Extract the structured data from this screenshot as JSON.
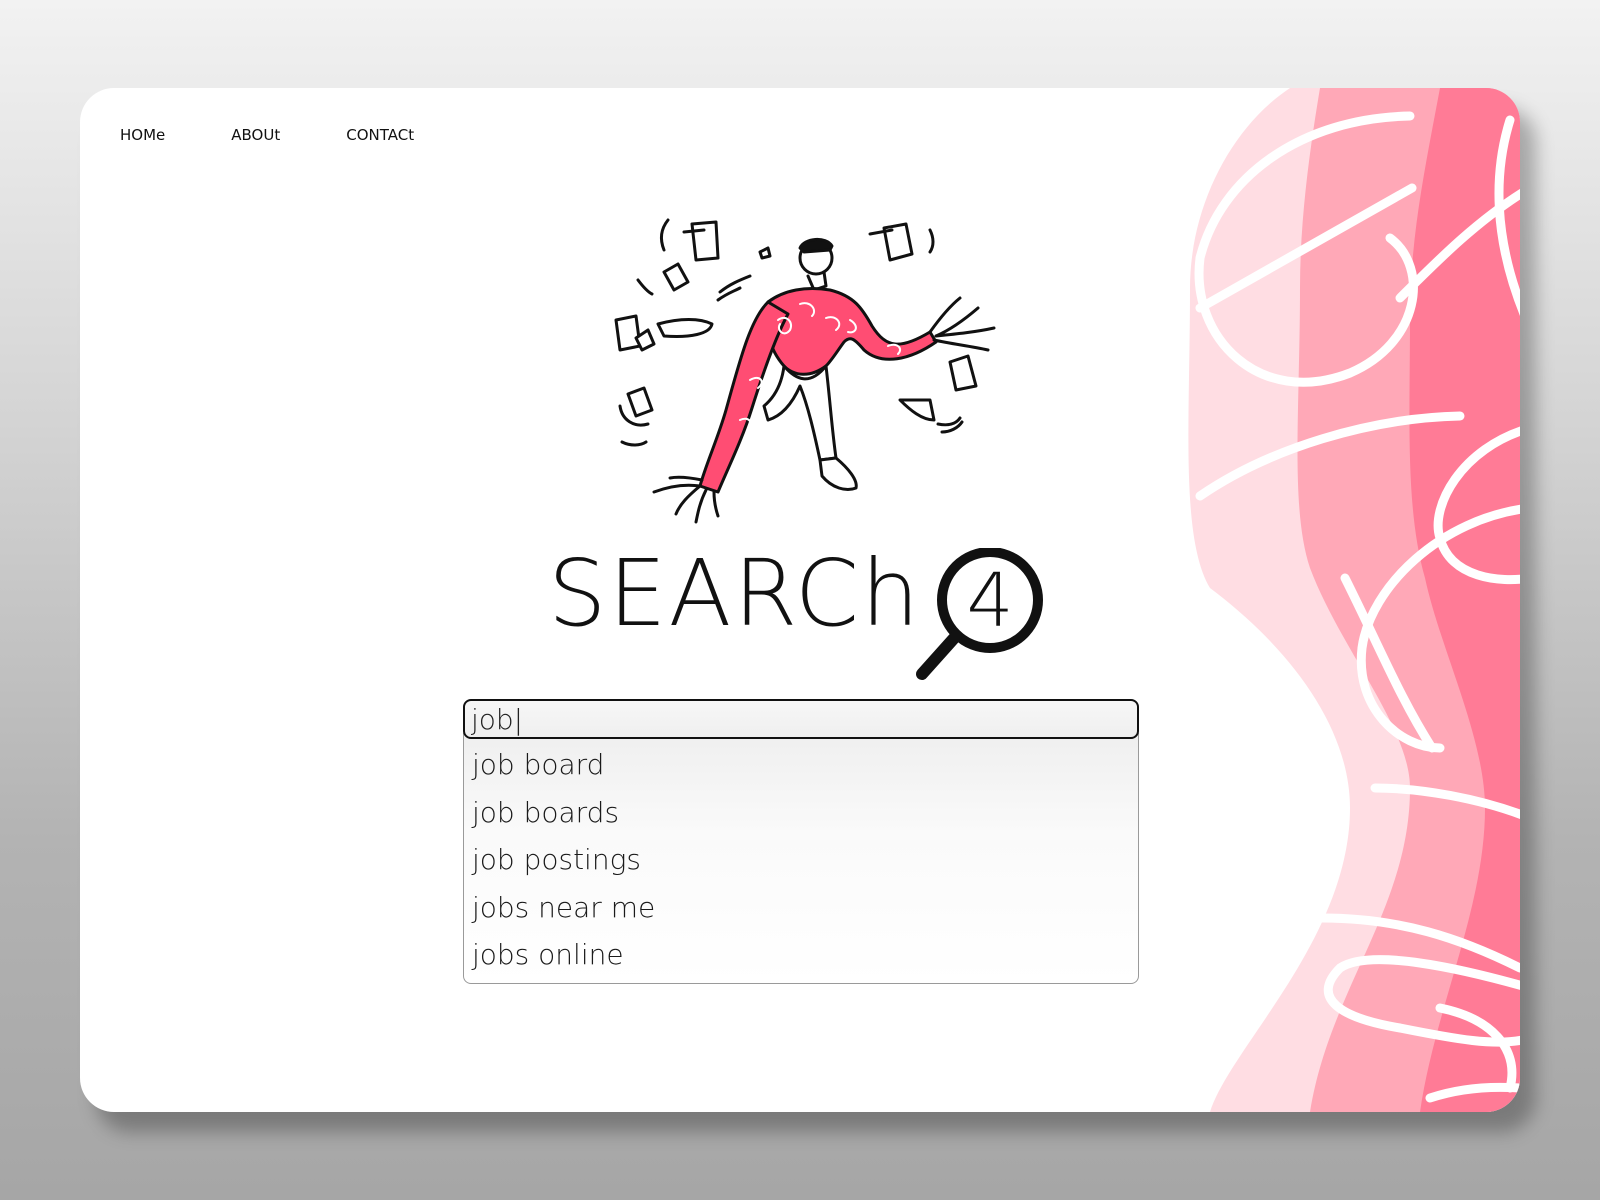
{
  "nav": {
    "items": [
      {
        "label": "HOMe"
      },
      {
        "label": "ABOUt"
      },
      {
        "label": "CONTACt"
      }
    ]
  },
  "brand": {
    "wordmark": "SEARCh",
    "mark_digit": "4"
  },
  "search": {
    "value": "job|",
    "suggestions": [
      {
        "label": "job board"
      },
      {
        "label": "job boards"
      },
      {
        "label": "job postings"
      },
      {
        "label": "jobs near me"
      },
      {
        "label": "jobs online"
      }
    ]
  },
  "colors": {
    "accent_dark": "#ff7b96",
    "accent_mid": "#ffa8b7",
    "accent_light": "#ffdde3",
    "text": "#111111"
  },
  "icons": {
    "logo_mark": "magnifier-icon",
    "hero": "person-juggling-papers-illustration"
  }
}
